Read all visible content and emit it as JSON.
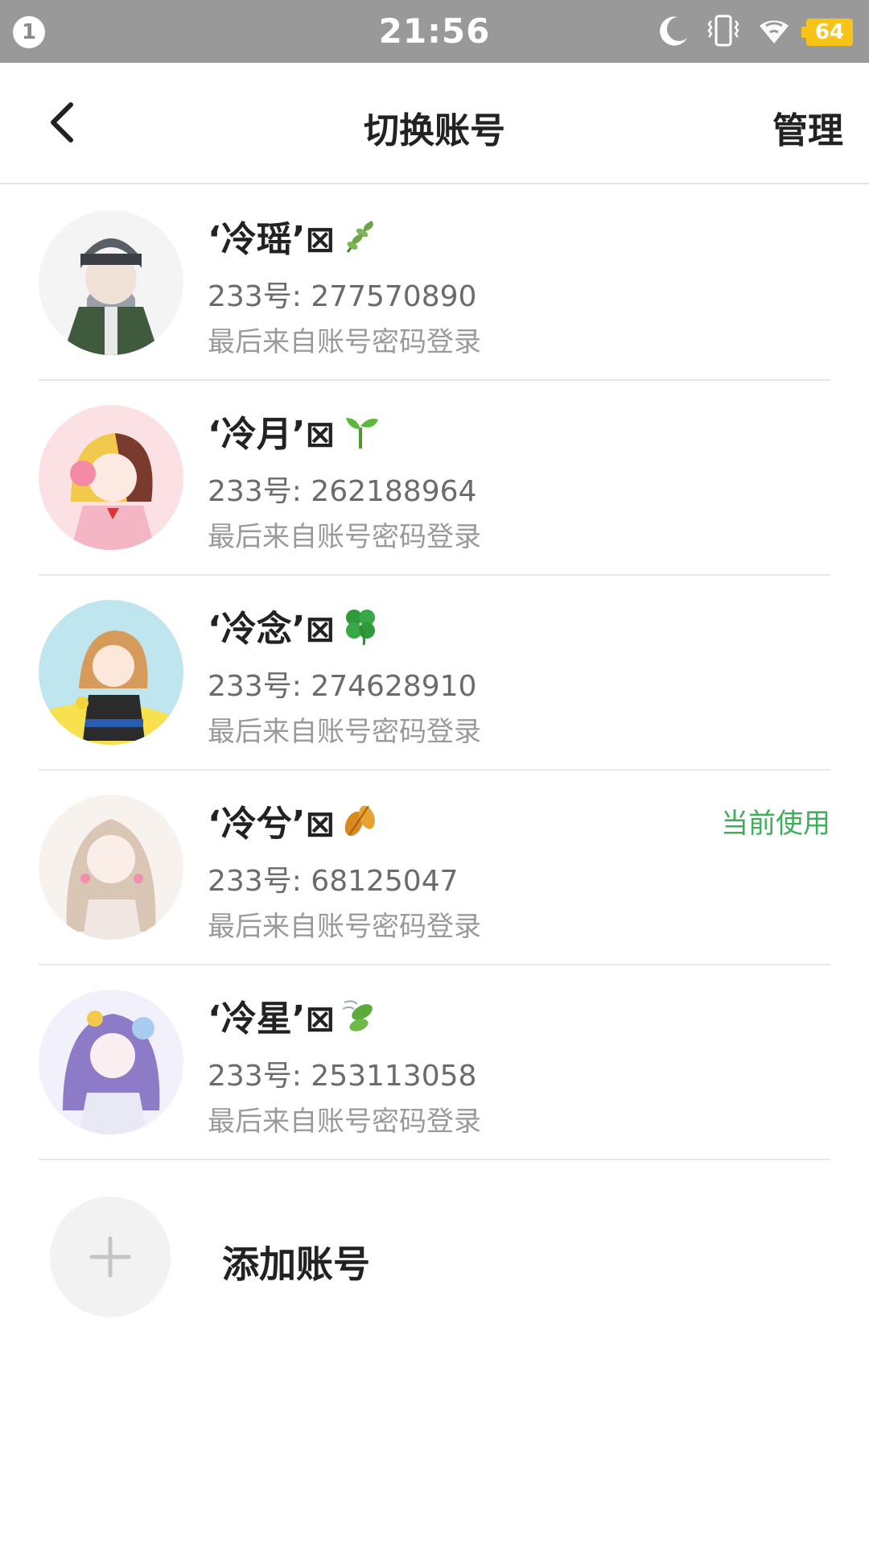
{
  "status_bar": {
    "notification_count": "1",
    "time": "21:56",
    "battery": "64",
    "icons": [
      "moon-icon",
      "vibrate-icon",
      "wifi-icon",
      "battery-icon"
    ]
  },
  "nav": {
    "back_icon": "chevron-left-icon",
    "title": "切换账号",
    "manage_label": "管理"
  },
  "accounts": [
    {
      "name": "‘冷瑶’⊠",
      "emoji_icon": "herb-icon",
      "uid": "233号: 277570890",
      "login_note": "最后来自账号密码登录",
      "current": ""
    },
    {
      "name": "‘冷月’⊠",
      "emoji_icon": "seedling-icon",
      "uid": "233号: 262188964",
      "login_note": "最后来自账号密码登录",
      "current": ""
    },
    {
      "name": "‘冷念’⊠",
      "emoji_icon": "four-leaf-clover-icon",
      "uid": "233号: 274628910",
      "login_note": "最后来自账号密码登录",
      "current": ""
    },
    {
      "name": "‘冷兮’⊠",
      "emoji_icon": "fallen-leaf-icon",
      "uid": "233号: 68125047",
      "login_note": "最后来自账号密码登录",
      "current": "当前使用"
    },
    {
      "name": "‘冷星’⊠",
      "emoji_icon": "leaf-wind-icon",
      "uid": "233号: 253113058",
      "login_note": "最后来自账号密码登录",
      "current": ""
    }
  ],
  "add_account": {
    "label": "添加账号",
    "icon": "plus-icon"
  },
  "colors": {
    "status_bar_bg": "#999999",
    "current_green": "#3fae5a",
    "battery_yellow": "#f6c318"
  }
}
